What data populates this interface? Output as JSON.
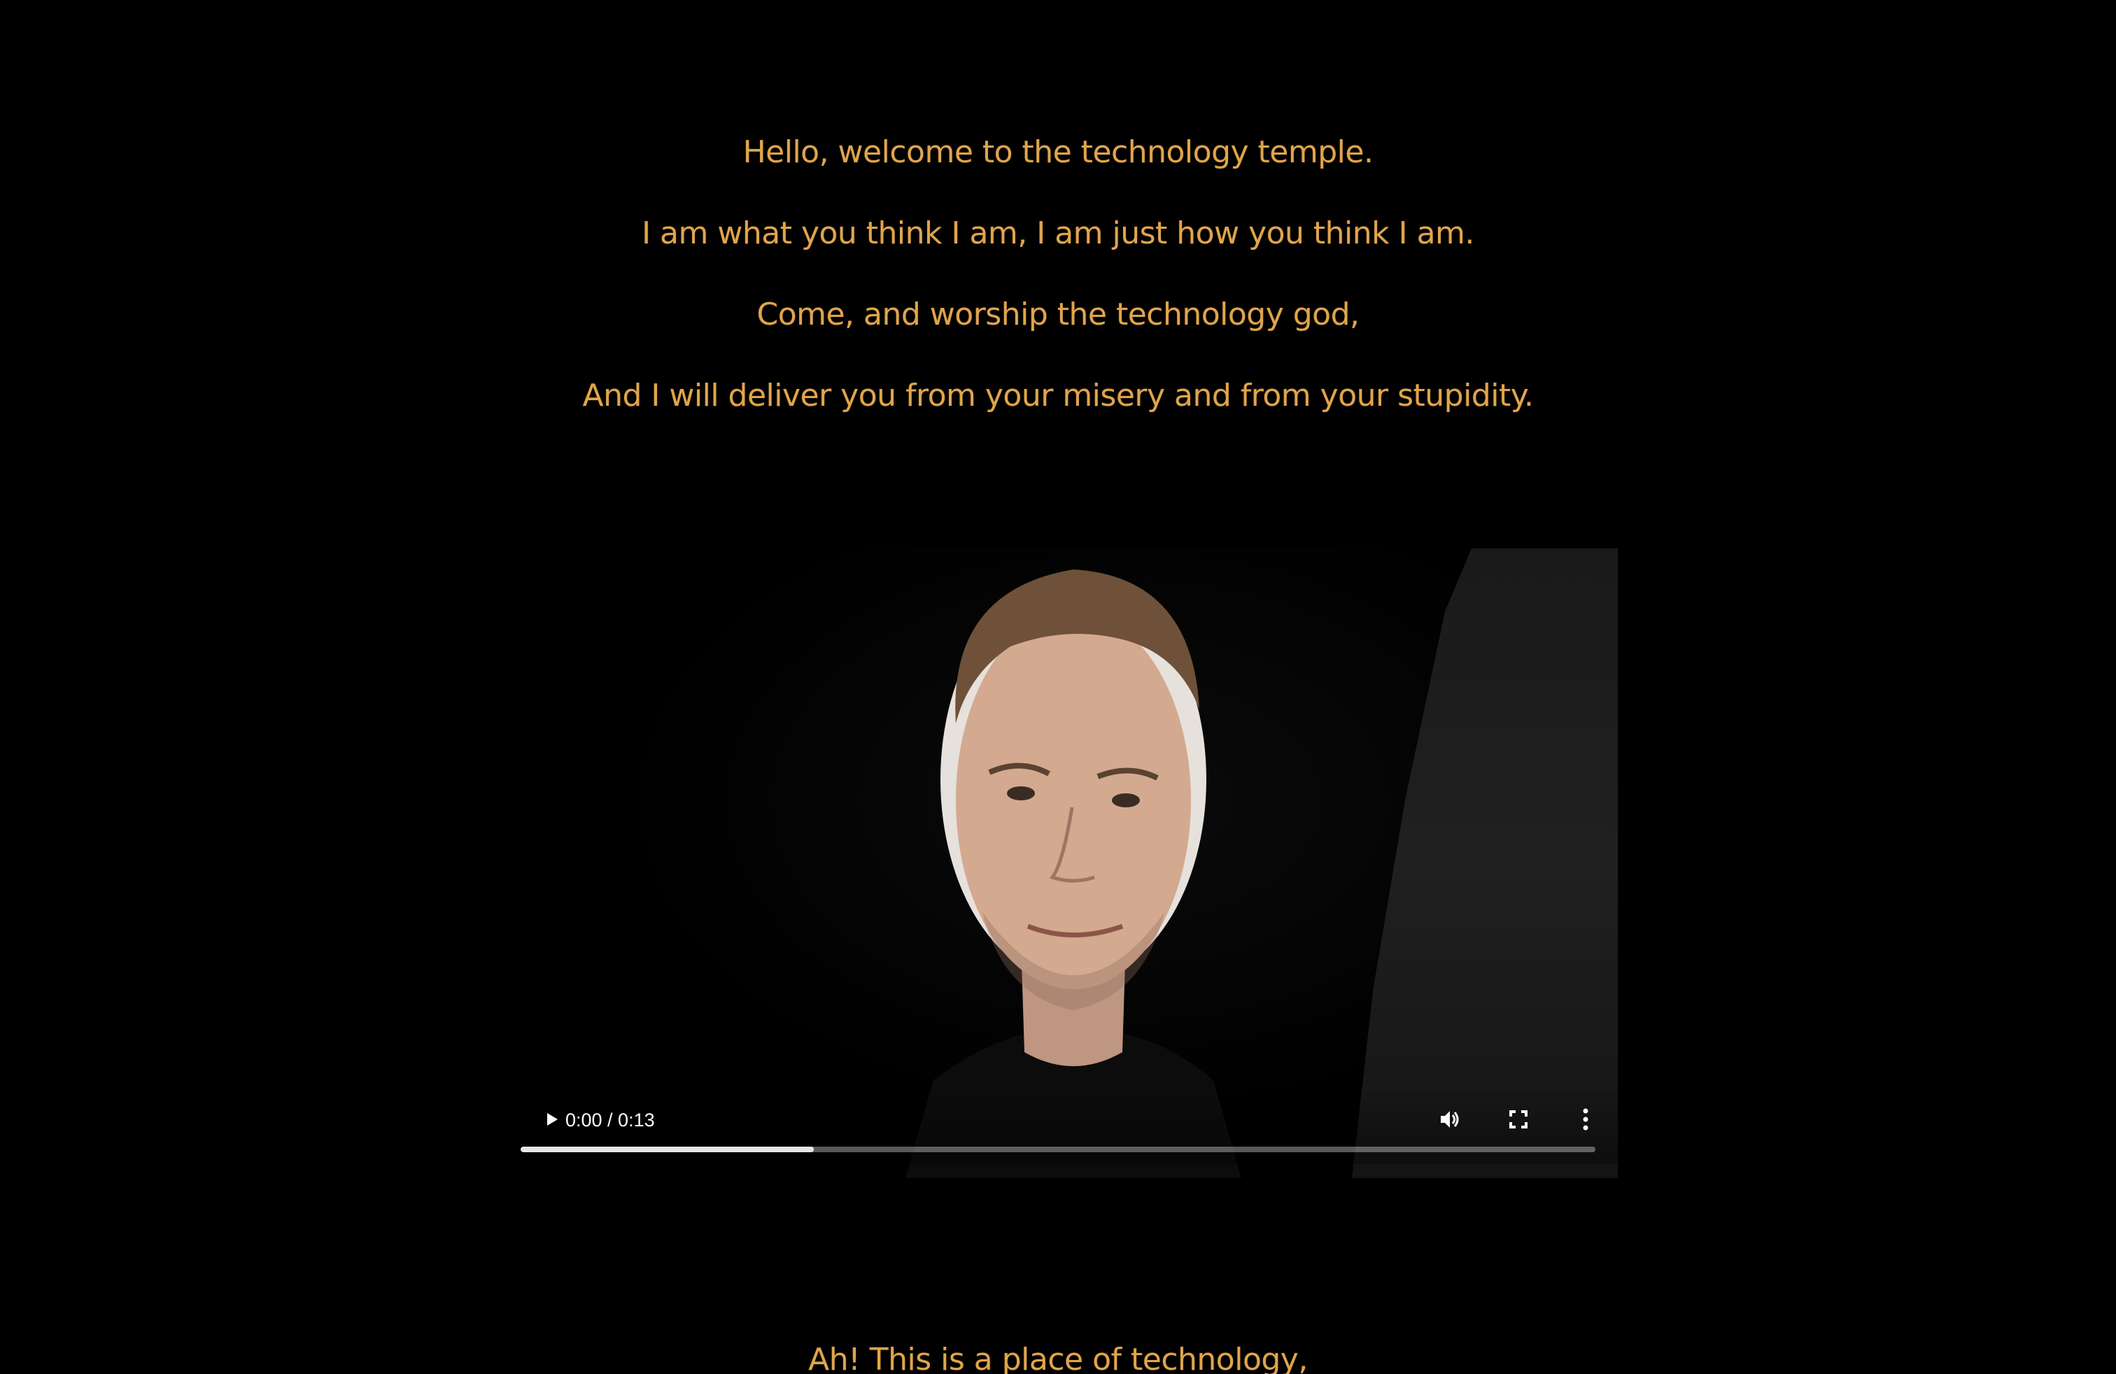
{
  "intro": {
    "lines": [
      "Hello, welcome to the technology temple.",
      "I am what you think I am, I am just how you think I am.",
      "Come, and worship the technology god,",
      "And I will deliver you from your misery and from your stupidity."
    ]
  },
  "video": {
    "time_display": "0:00 / 0:13",
    "buffered_fraction": 0.273,
    "icons": {
      "play": "play-icon",
      "volume": "volume-icon",
      "fullscreen": "fullscreen-icon",
      "more": "more-options-icon"
    }
  },
  "outro": {
    "lines": [
      "Ah! This is a place of technology,"
    ]
  },
  "colors": {
    "background": "#000000",
    "text_accent": "#e0a54c",
    "controls": "#ffffff"
  }
}
